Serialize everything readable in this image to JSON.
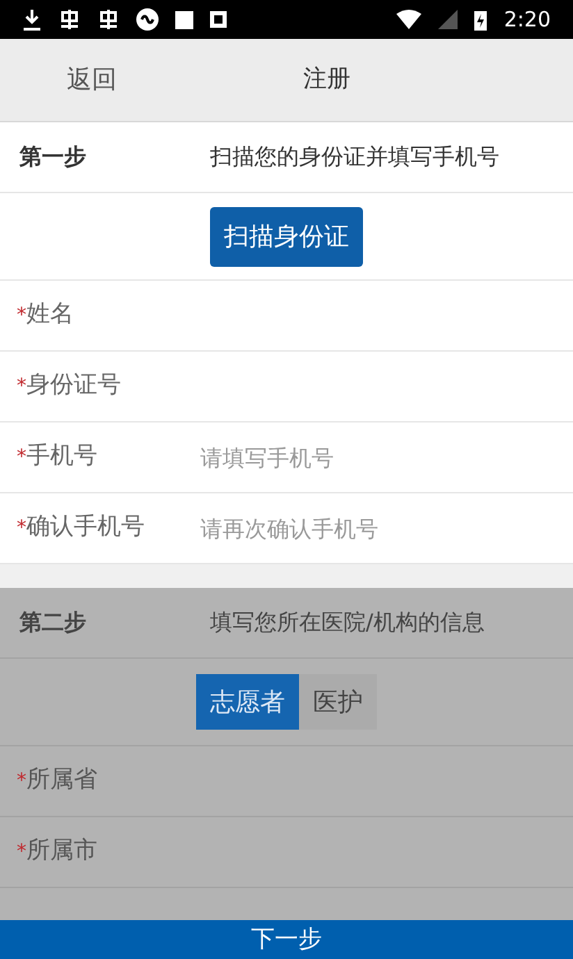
{
  "status_bar": {
    "time": "2:20"
  },
  "header": {
    "back": "返回",
    "title": "注册"
  },
  "sections": [
    {
      "step": "第一步",
      "description": "扫描您的身份证并填写手机号",
      "dimmed": false,
      "action": {
        "kind": "button",
        "label": "扫描身份证"
      },
      "fields": [
        {
          "label": "姓名",
          "required_mark": "*"
        },
        {
          "label": "身份证号",
          "required_mark": "*"
        },
        {
          "label": "手机号",
          "required_mark": "*",
          "placeholder": "请填写手机号"
        },
        {
          "label": "确认手机号",
          "required_mark": "*",
          "placeholder": "请再次确认手机号"
        }
      ]
    },
    {
      "step": "第二步",
      "description": "填写您所在医院/机构的信息",
      "dimmed": true,
      "action": {
        "kind": "toggle",
        "options": [
          {
            "label": "志愿者",
            "selected": true
          },
          {
            "label": "医护",
            "selected": false
          }
        ]
      },
      "fields": [
        {
          "label": "所属省",
          "required_mark": "*"
        },
        {
          "label": "所属市",
          "required_mark": "*"
        }
      ]
    }
  ],
  "next_button": "下一步"
}
